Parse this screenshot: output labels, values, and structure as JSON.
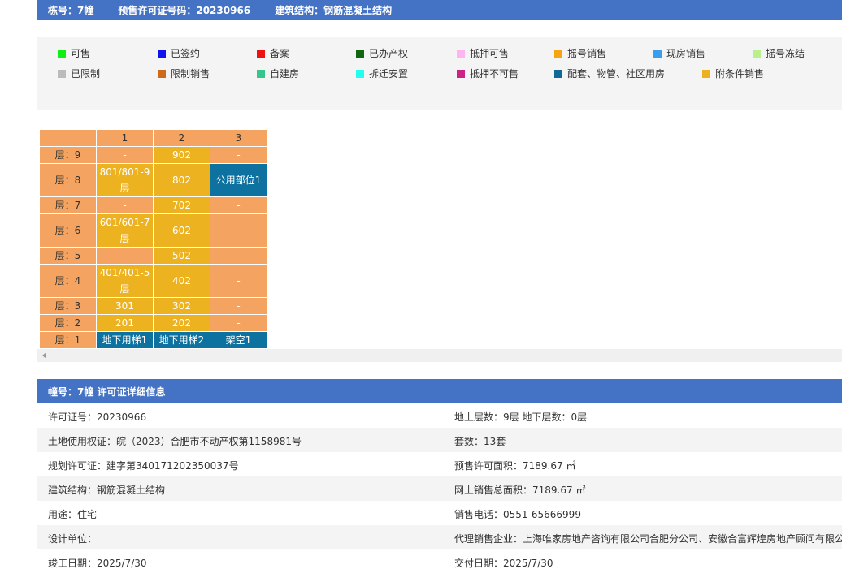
{
  "topbar": {
    "building": "栋号：7幢",
    "permit": "预售许可证号码：20230966",
    "structure": "建筑结构：钢筋混凝土结构"
  },
  "legend": {
    "row1": [
      {
        "label": "可售",
        "color": "#11ee11"
      },
      {
        "label": "已签约",
        "color": "#1111ee"
      },
      {
        "label": "备案",
        "color": "#ee1111"
      },
      {
        "label": "已办产权",
        "color": "#116611"
      },
      {
        "label": "抵押可售",
        "color": "#ffb6f0"
      },
      {
        "label": "摇号销售",
        "color": "#f6a512"
      },
      {
        "label": "现房销售",
        "color": "#3d9ded"
      },
      {
        "label": "摇号冻结",
        "color": "#b9f08d"
      }
    ],
    "row2": [
      {
        "label": "已限制",
        "color": "#bbbbbb"
      },
      {
        "label": "限制销售",
        "color": "#cc6b1c"
      },
      {
        "label": "自建房",
        "color": "#36c58a"
      },
      {
        "label": "拆迁安置",
        "color": "#22ffee"
      },
      {
        "label": "抵押不可售",
        "color": "#cc2288"
      },
      {
        "label": "配套、物管、社区用房",
        "color": "#0f6996"
      },
      {
        "label": "附条件销售",
        "color": "#edb220"
      }
    ]
  },
  "grid": {
    "columns": [
      "",
      "1",
      "2",
      "3"
    ],
    "rows": [
      {
        "floor": "层：9",
        "cells": [
          {
            "t": "-",
            "c": "or"
          },
          {
            "t": "902",
            "c": "yl"
          },
          {
            "t": "-",
            "c": "or"
          }
        ]
      },
      {
        "floor": "层：8",
        "tall": true,
        "cells": [
          {
            "t": "801/801-9\n层",
            "c": "yl"
          },
          {
            "t": "802",
            "c": "yl"
          },
          {
            "t": "公用部位1",
            "c": "bl"
          }
        ]
      },
      {
        "floor": "层：7",
        "cells": [
          {
            "t": "-",
            "c": "or"
          },
          {
            "t": "702",
            "c": "yl"
          },
          {
            "t": "-",
            "c": "or"
          }
        ]
      },
      {
        "floor": "层：6",
        "tall": true,
        "cells": [
          {
            "t": "601/601-7\n层",
            "c": "yl"
          },
          {
            "t": "602",
            "c": "yl"
          },
          {
            "t": "-",
            "c": "or"
          }
        ]
      },
      {
        "floor": "层：5",
        "cells": [
          {
            "t": "-",
            "c": "or"
          },
          {
            "t": "502",
            "c": "yl"
          },
          {
            "t": "-",
            "c": "or"
          }
        ]
      },
      {
        "floor": "层：4",
        "tall": true,
        "cells": [
          {
            "t": "401/401-5\n层",
            "c": "yl"
          },
          {
            "t": "402",
            "c": "yl"
          },
          {
            "t": "-",
            "c": "or"
          }
        ]
      },
      {
        "floor": "层：3",
        "cells": [
          {
            "t": "301",
            "c": "yl"
          },
          {
            "t": "302",
            "c": "yl"
          },
          {
            "t": "-",
            "c": "or"
          }
        ]
      },
      {
        "floor": "层：2",
        "cells": [
          {
            "t": "201",
            "c": "yl"
          },
          {
            "t": "202",
            "c": "yl"
          },
          {
            "t": "-",
            "c": "or"
          }
        ]
      },
      {
        "floor": "层：1",
        "cells": [
          {
            "t": "地下用梯1",
            "c": "bl"
          },
          {
            "t": "地下用梯2",
            "c": "bl"
          },
          {
            "t": "架空1",
            "c": "bl"
          }
        ]
      }
    ]
  },
  "detail": {
    "title": "幢号：7幢 许可证详细信息",
    "rows": [
      {
        "left": "许可证号：20230966",
        "right": "地上层数：9层  地下层数：0层"
      },
      {
        "left": "土地使用权证：皖（2023）合肥市不动产权第1158981号",
        "right": "套数：13套"
      },
      {
        "left": "规划许可证：建字第340171202350037号",
        "right": "预售许可面积：7189.67 ㎡"
      },
      {
        "left": "建筑结构：钢筋混凝土结构",
        "right": "网上销售总面积：7189.67 ㎡"
      },
      {
        "left": "用途：住宅",
        "right": "销售电话：0551-65666999"
      },
      {
        "left": "设计单位：",
        "right": "代理销售企业：上海唯家房地产咨询有限公司合肥分公司、安徽合富辉煌房地产顾问有限公司"
      },
      {
        "left": "竣工日期：2025/7/30",
        "right": "交付日期：2025/7/30"
      }
    ]
  }
}
